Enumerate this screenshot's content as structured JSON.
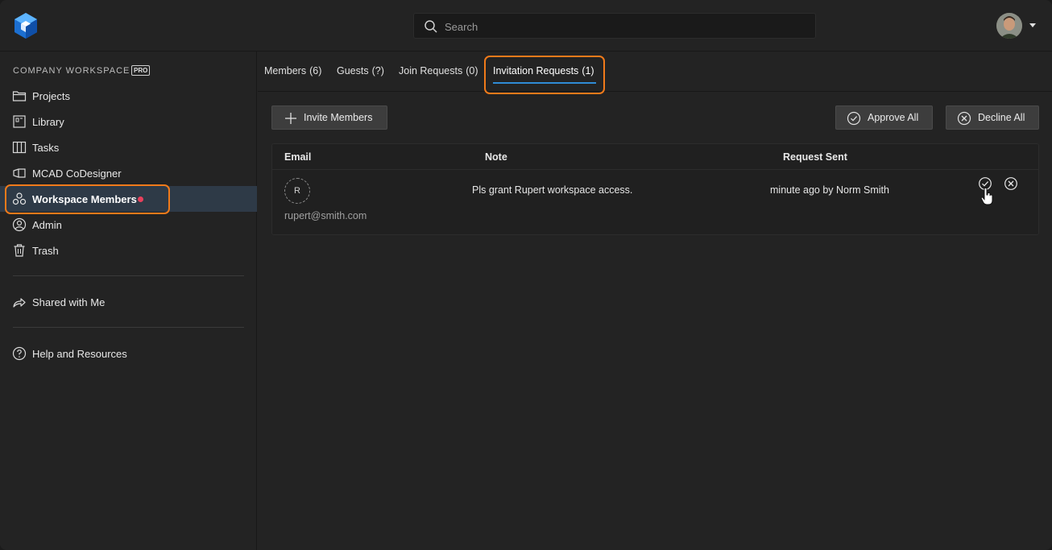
{
  "search": {
    "placeholder": "Search"
  },
  "sidebar": {
    "workspace_title": "COMPANY WORKSPACE",
    "workspace_badge": "PRO",
    "items": [
      {
        "label": "Projects",
        "icon": "folder-icon"
      },
      {
        "label": "Library",
        "icon": "library-icon"
      },
      {
        "label": "Tasks",
        "icon": "tasks-icon"
      },
      {
        "label": "MCAD CoDesigner",
        "icon": "mcad-icon"
      },
      {
        "label": "Workspace Members",
        "icon": "members-icon",
        "active": true,
        "notification": true
      },
      {
        "label": "Admin",
        "icon": "user-icon"
      },
      {
        "label": "Trash",
        "icon": "trash-icon"
      },
      {
        "label": "Shared with Me",
        "icon": "share-icon"
      },
      {
        "label": "Help and Resources",
        "icon": "help-icon"
      }
    ]
  },
  "tabs": [
    {
      "label": "Members",
      "count": "(6)"
    },
    {
      "label": "Guests",
      "count": "(?)"
    },
    {
      "label": "Join Requests",
      "count": "(0)"
    },
    {
      "label": "Invitation Requests",
      "count": "(1)",
      "active": true
    }
  ],
  "toolbar": {
    "invite_label": "Invite Members",
    "approve_all_label": "Approve All",
    "decline_all_label": "Decline All"
  },
  "table": {
    "headers": {
      "email": "Email",
      "note": "Note",
      "request_sent": "Request Sent"
    },
    "rows": [
      {
        "avatar_initial": "R",
        "email": "rupert@smith.com",
        "note": "Pls grant Rupert workspace access.",
        "request_sent": "minute ago by Norm Smith"
      }
    ]
  },
  "colors": {
    "highlight": "#f07a1a",
    "active_tab_underline": "#2f8cd6",
    "notification_dot": "#e8405c",
    "active_nav_bg": "#2e3a47"
  }
}
